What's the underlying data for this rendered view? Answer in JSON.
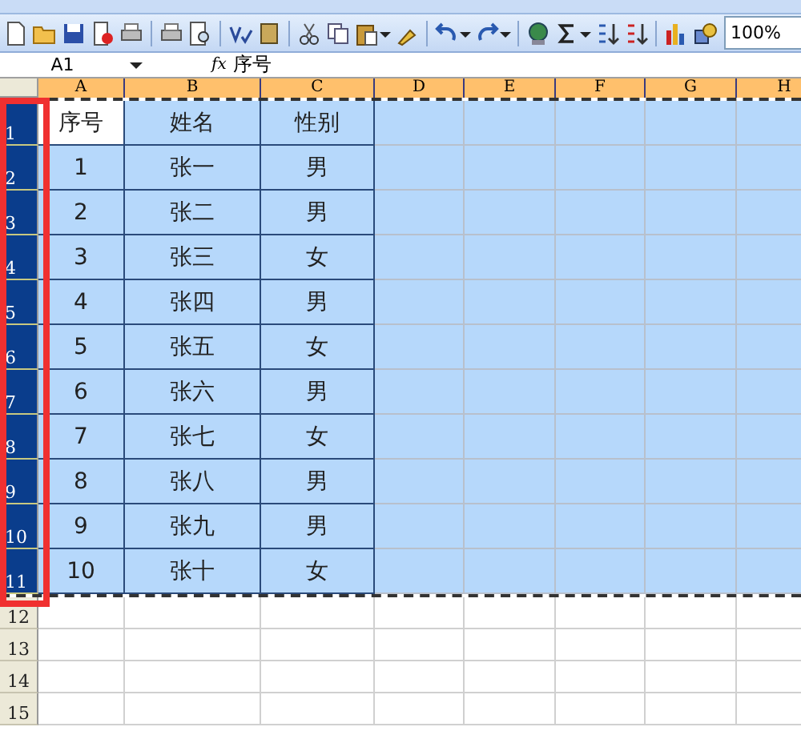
{
  "toolbar": {
    "zoom": "100%"
  },
  "formula_bar": {
    "name_box": "A1",
    "function_label": "fx",
    "formula": "序号"
  },
  "columns": [
    {
      "label": "A",
      "selected": true
    },
    {
      "label": "B",
      "selected": true
    },
    {
      "label": "C",
      "selected": true
    },
    {
      "label": "D",
      "selected": true
    },
    {
      "label": "E",
      "selected": true
    },
    {
      "label": "F",
      "selected": true
    },
    {
      "label": "G",
      "selected": true
    },
    {
      "label": "H",
      "selected": true
    }
  ],
  "rows": [
    {
      "label": "1",
      "selected": true,
      "cells": [
        {
          "text": "序号",
          "active": true
        },
        {
          "text": "姓名",
          "active": false
        },
        {
          "text": "性别",
          "active": false
        }
      ]
    },
    {
      "label": "2",
      "selected": true,
      "cells": [
        {
          "text": "1",
          "active": false
        },
        {
          "text": "张一",
          "active": false
        },
        {
          "text": "男",
          "active": false
        }
      ]
    },
    {
      "label": "3",
      "selected": true,
      "cells": [
        {
          "text": "2",
          "active": false
        },
        {
          "text": "张二",
          "active": false
        },
        {
          "text": "男",
          "active": false
        }
      ]
    },
    {
      "label": "4",
      "selected": true,
      "cells": [
        {
          "text": "3",
          "active": false
        },
        {
          "text": "张三",
          "active": false
        },
        {
          "text": "女",
          "active": false
        }
      ]
    },
    {
      "label": "5",
      "selected": true,
      "cells": [
        {
          "text": "4",
          "active": false
        },
        {
          "text": "张四",
          "active": false
        },
        {
          "text": "男",
          "active": false
        }
      ]
    },
    {
      "label": "6",
      "selected": true,
      "cells": [
        {
          "text": "5",
          "active": false
        },
        {
          "text": "张五",
          "active": false
        },
        {
          "text": "女",
          "active": false
        }
      ]
    },
    {
      "label": "7",
      "selected": true,
      "cells": [
        {
          "text": "6",
          "active": false
        },
        {
          "text": "张六",
          "active": false
        },
        {
          "text": "男",
          "active": false
        }
      ]
    },
    {
      "label": "8",
      "selected": true,
      "cells": [
        {
          "text": "7",
          "active": false
        },
        {
          "text": "张七",
          "active": false
        },
        {
          "text": "女",
          "active": false
        }
      ]
    },
    {
      "label": "9",
      "selected": true,
      "cells": [
        {
          "text": "8",
          "active": false
        },
        {
          "text": "张八",
          "active": false
        },
        {
          "text": "男",
          "active": false
        }
      ]
    },
    {
      "label": "10",
      "selected": true,
      "cells": [
        {
          "text": "9",
          "active": false
        },
        {
          "text": "张九",
          "active": false
        },
        {
          "text": "男",
          "active": false
        }
      ]
    },
    {
      "label": "11",
      "selected": true,
      "cells": [
        {
          "text": "10",
          "active": false
        },
        {
          "text": "张十",
          "active": false
        },
        {
          "text": "女",
          "active": false
        }
      ]
    },
    {
      "label": "12",
      "selected": false
    },
    {
      "label": "13",
      "selected": false
    },
    {
      "label": "14",
      "selected": false
    },
    {
      "label": "15",
      "selected": false
    }
  ]
}
